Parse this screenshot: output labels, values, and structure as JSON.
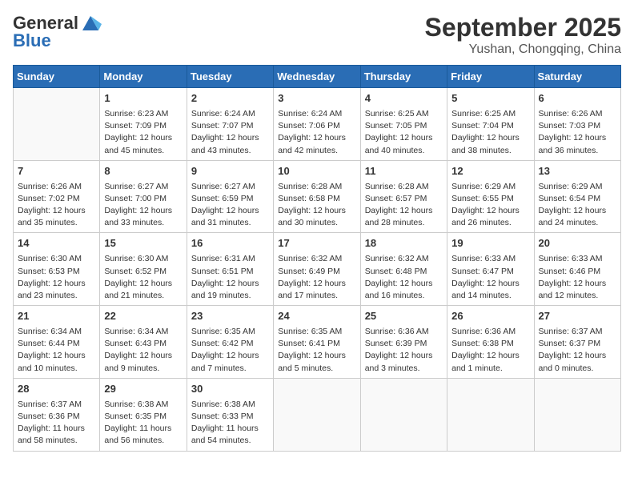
{
  "header": {
    "logo_general": "General",
    "logo_blue": "Blue",
    "month": "September 2025",
    "location": "Yushan, Chongqing, China"
  },
  "weekdays": [
    "Sunday",
    "Monday",
    "Tuesday",
    "Wednesday",
    "Thursday",
    "Friday",
    "Saturday"
  ],
  "weeks": [
    [
      {
        "day": "",
        "details": ""
      },
      {
        "day": "1",
        "details": "Sunrise: 6:23 AM\nSunset: 7:09 PM\nDaylight: 12 hours\nand 45 minutes."
      },
      {
        "day": "2",
        "details": "Sunrise: 6:24 AM\nSunset: 7:07 PM\nDaylight: 12 hours\nand 43 minutes."
      },
      {
        "day": "3",
        "details": "Sunrise: 6:24 AM\nSunset: 7:06 PM\nDaylight: 12 hours\nand 42 minutes."
      },
      {
        "day": "4",
        "details": "Sunrise: 6:25 AM\nSunset: 7:05 PM\nDaylight: 12 hours\nand 40 minutes."
      },
      {
        "day": "5",
        "details": "Sunrise: 6:25 AM\nSunset: 7:04 PM\nDaylight: 12 hours\nand 38 minutes."
      },
      {
        "day": "6",
        "details": "Sunrise: 6:26 AM\nSunset: 7:03 PM\nDaylight: 12 hours\nand 36 minutes."
      }
    ],
    [
      {
        "day": "7",
        "details": "Sunrise: 6:26 AM\nSunset: 7:02 PM\nDaylight: 12 hours\nand 35 minutes."
      },
      {
        "day": "8",
        "details": "Sunrise: 6:27 AM\nSunset: 7:00 PM\nDaylight: 12 hours\nand 33 minutes."
      },
      {
        "day": "9",
        "details": "Sunrise: 6:27 AM\nSunset: 6:59 PM\nDaylight: 12 hours\nand 31 minutes."
      },
      {
        "day": "10",
        "details": "Sunrise: 6:28 AM\nSunset: 6:58 PM\nDaylight: 12 hours\nand 30 minutes."
      },
      {
        "day": "11",
        "details": "Sunrise: 6:28 AM\nSunset: 6:57 PM\nDaylight: 12 hours\nand 28 minutes."
      },
      {
        "day": "12",
        "details": "Sunrise: 6:29 AM\nSunset: 6:55 PM\nDaylight: 12 hours\nand 26 minutes."
      },
      {
        "day": "13",
        "details": "Sunrise: 6:29 AM\nSunset: 6:54 PM\nDaylight: 12 hours\nand 24 minutes."
      }
    ],
    [
      {
        "day": "14",
        "details": "Sunrise: 6:30 AM\nSunset: 6:53 PM\nDaylight: 12 hours\nand 23 minutes."
      },
      {
        "day": "15",
        "details": "Sunrise: 6:30 AM\nSunset: 6:52 PM\nDaylight: 12 hours\nand 21 minutes."
      },
      {
        "day": "16",
        "details": "Sunrise: 6:31 AM\nSunset: 6:51 PM\nDaylight: 12 hours\nand 19 minutes."
      },
      {
        "day": "17",
        "details": "Sunrise: 6:32 AM\nSunset: 6:49 PM\nDaylight: 12 hours\nand 17 minutes."
      },
      {
        "day": "18",
        "details": "Sunrise: 6:32 AM\nSunset: 6:48 PM\nDaylight: 12 hours\nand 16 minutes."
      },
      {
        "day": "19",
        "details": "Sunrise: 6:33 AM\nSunset: 6:47 PM\nDaylight: 12 hours\nand 14 minutes."
      },
      {
        "day": "20",
        "details": "Sunrise: 6:33 AM\nSunset: 6:46 PM\nDaylight: 12 hours\nand 12 minutes."
      }
    ],
    [
      {
        "day": "21",
        "details": "Sunrise: 6:34 AM\nSunset: 6:44 PM\nDaylight: 12 hours\nand 10 minutes."
      },
      {
        "day": "22",
        "details": "Sunrise: 6:34 AM\nSunset: 6:43 PM\nDaylight: 12 hours\nand 9 minutes."
      },
      {
        "day": "23",
        "details": "Sunrise: 6:35 AM\nSunset: 6:42 PM\nDaylight: 12 hours\nand 7 minutes."
      },
      {
        "day": "24",
        "details": "Sunrise: 6:35 AM\nSunset: 6:41 PM\nDaylight: 12 hours\nand 5 minutes."
      },
      {
        "day": "25",
        "details": "Sunrise: 6:36 AM\nSunset: 6:39 PM\nDaylight: 12 hours\nand 3 minutes."
      },
      {
        "day": "26",
        "details": "Sunrise: 6:36 AM\nSunset: 6:38 PM\nDaylight: 12 hours\nand 1 minute."
      },
      {
        "day": "27",
        "details": "Sunrise: 6:37 AM\nSunset: 6:37 PM\nDaylight: 12 hours\nand 0 minutes."
      }
    ],
    [
      {
        "day": "28",
        "details": "Sunrise: 6:37 AM\nSunset: 6:36 PM\nDaylight: 11 hours\nand 58 minutes."
      },
      {
        "day": "29",
        "details": "Sunrise: 6:38 AM\nSunset: 6:35 PM\nDaylight: 11 hours\nand 56 minutes."
      },
      {
        "day": "30",
        "details": "Sunrise: 6:38 AM\nSunset: 6:33 PM\nDaylight: 11 hours\nand 54 minutes."
      },
      {
        "day": "",
        "details": ""
      },
      {
        "day": "",
        "details": ""
      },
      {
        "day": "",
        "details": ""
      },
      {
        "day": "",
        "details": ""
      }
    ]
  ]
}
